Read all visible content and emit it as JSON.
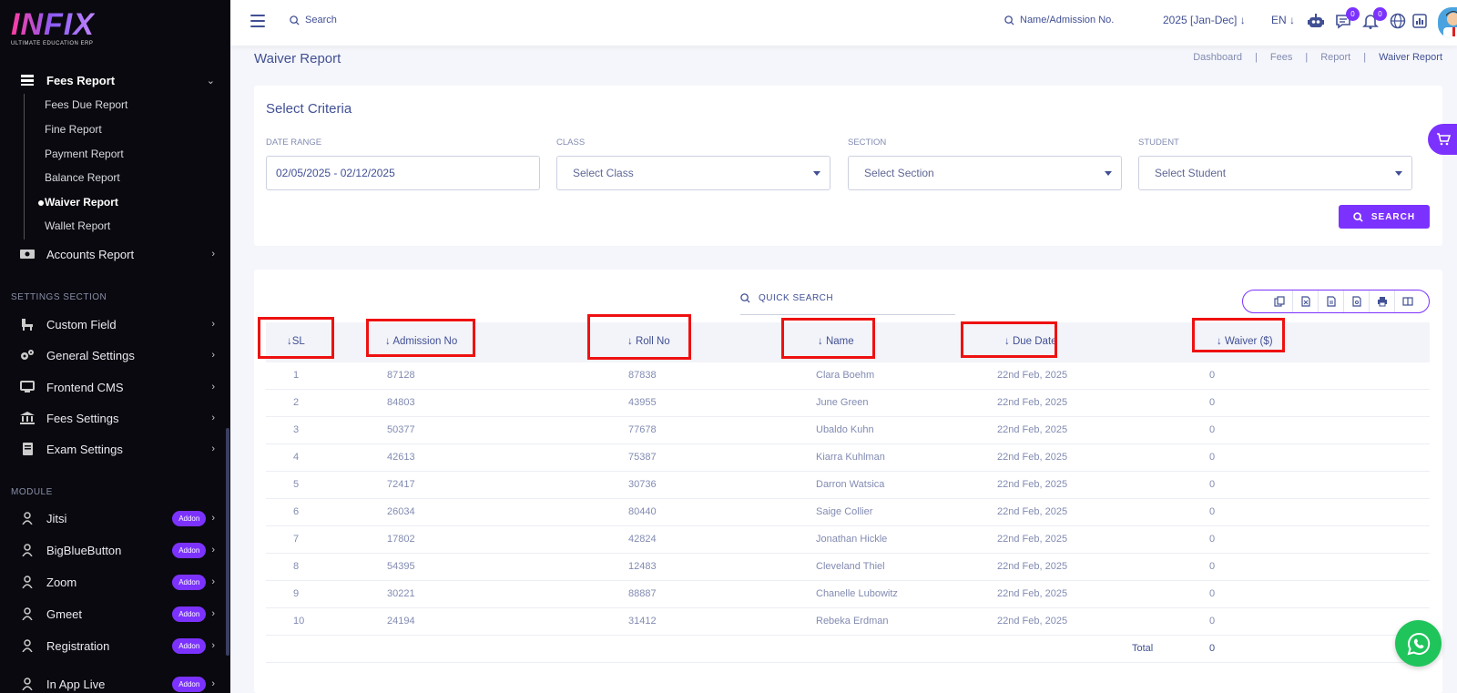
{
  "brand": {
    "logo": "INFIX",
    "tagline": "ULTIMATE EDUCATION ERP"
  },
  "sidebar": {
    "fees_report": {
      "label": "Fees Report"
    },
    "submenu": [
      {
        "label": "Fees Due Report"
      },
      {
        "label": "Fine Report"
      },
      {
        "label": "Payment Report"
      },
      {
        "label": "Balance Report"
      },
      {
        "label": "Waiver Report",
        "active": true
      },
      {
        "label": "Wallet Report"
      }
    ],
    "accounts_report": {
      "label": "Accounts Report"
    },
    "settings_section_title": "SETTINGS SECTION",
    "settings": [
      {
        "label": "Custom Field"
      },
      {
        "label": "General Settings"
      },
      {
        "label": "Frontend CMS"
      },
      {
        "label": "Fees Settings"
      },
      {
        "label": "Exam Settings"
      }
    ],
    "module_title": "MODULE",
    "modules": [
      {
        "label": "Jitsi",
        "badge": "Addon"
      },
      {
        "label": "BigBlueButton",
        "badge": "Addon"
      },
      {
        "label": "Zoom",
        "badge": "Addon"
      },
      {
        "label": "Gmeet",
        "badge": "Addon"
      },
      {
        "label": "Registration",
        "badge": "Addon"
      },
      {
        "label": "In App Live",
        "badge": "Addon"
      }
    ]
  },
  "topbar": {
    "search_placeholder": "Search",
    "name_search_placeholder": "Name/Admission No.",
    "year": "2025 [Jan-Dec]",
    "language": "EN",
    "chat_badge": "0",
    "notification_badge": "0"
  },
  "page": {
    "title": "Waiver Report",
    "breadcrumb": [
      "Dashboard",
      "Fees",
      "Report",
      "Waiver Report"
    ]
  },
  "criteria": {
    "title": "Select Criteria",
    "date_range": {
      "label": "DATE RANGE",
      "value": "02/05/2025 - 02/12/2025"
    },
    "class": {
      "label": "CLASS",
      "value": "Select Class"
    },
    "section": {
      "label": "SECTION",
      "value": "Select Section"
    },
    "student": {
      "label": "STUDENT",
      "value": "Select Student"
    },
    "search_button": "SEARCH"
  },
  "table": {
    "quick_search": "QUICK SEARCH",
    "columns": [
      "SL",
      "Admission No",
      "Roll No",
      "Name",
      "Due Date",
      "Waiver ($)"
    ],
    "rows": [
      [
        "1",
        "87128",
        "87838",
        "Clara Boehm",
        "22nd Feb, 2025",
        "0"
      ],
      [
        "2",
        "84803",
        "43955",
        "June Green",
        "22nd Feb, 2025",
        "0"
      ],
      [
        "3",
        "50377",
        "77678",
        "Ubaldo Kuhn",
        "22nd Feb, 2025",
        "0"
      ],
      [
        "4",
        "42613",
        "75387",
        "Kiarra Kuhlman",
        "22nd Feb, 2025",
        "0"
      ],
      [
        "5",
        "72417",
        "30736",
        "Darron Watsica",
        "22nd Feb, 2025",
        "0"
      ],
      [
        "6",
        "26034",
        "80440",
        "Saige Collier",
        "22nd Feb, 2025",
        "0"
      ],
      [
        "7",
        "17802",
        "42824",
        "Jonathan Hickle",
        "22nd Feb, 2025",
        "0"
      ],
      [
        "8",
        "54395",
        "12483",
        "Cleveland Thiel",
        "22nd Feb, 2025",
        "0"
      ],
      [
        "9",
        "30221",
        "88887",
        "Chanelle Lubowitz",
        "22nd Feb, 2025",
        "0"
      ],
      [
        "10",
        "24194",
        "31412",
        "Rebeka Erdman",
        "22nd Feb, 2025",
        "0"
      ]
    ],
    "total_label": "Total",
    "total_value": "0"
  },
  "colors": {
    "accent": "#7c32ff",
    "sidebar_bg": "#09090f",
    "text": "#415094",
    "highlight_box": "#ee1111",
    "whatsapp": "#1fc45b"
  }
}
